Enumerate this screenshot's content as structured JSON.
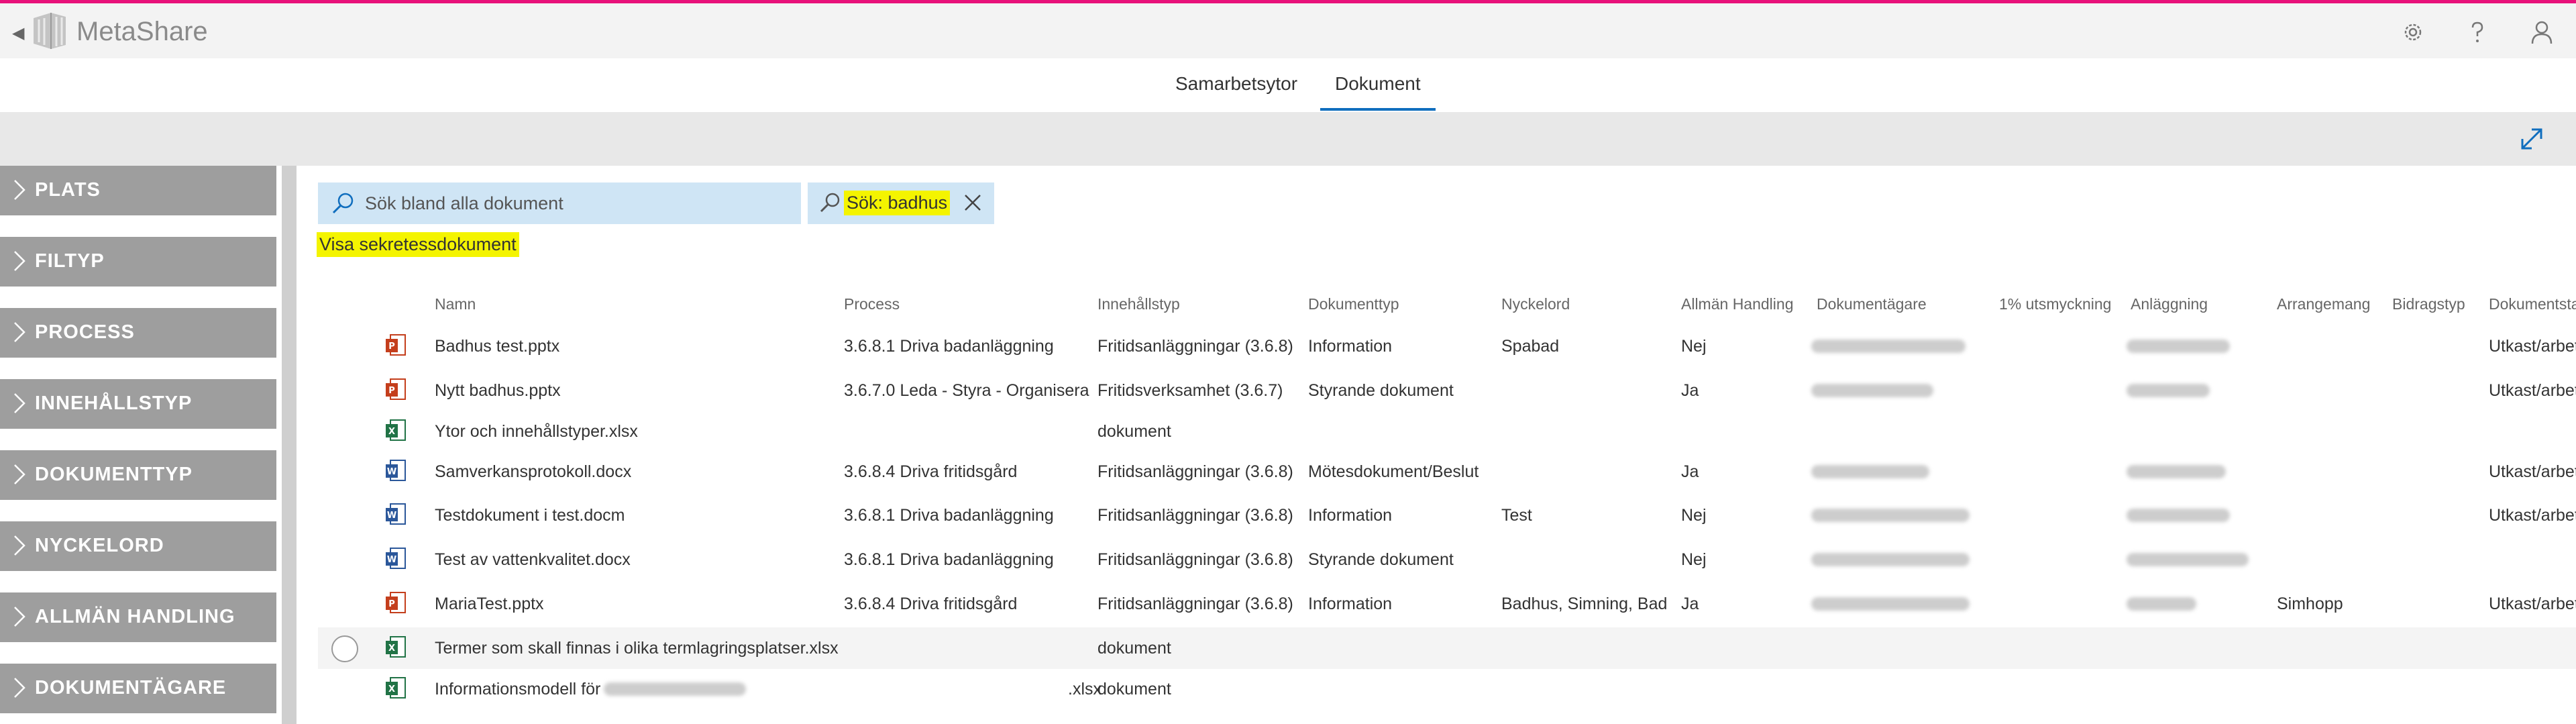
{
  "app": {
    "title": "MetaShare"
  },
  "nav": {
    "tabs": [
      {
        "label": "Samarbetsytor"
      },
      {
        "label": "Dokument"
      }
    ]
  },
  "sidebar": {
    "items": [
      {
        "label": "PLATS"
      },
      {
        "label": "FILTYP"
      },
      {
        "label": "PROCESS"
      },
      {
        "label": "INNEHÅLLSTYP"
      },
      {
        "label": "DOKUMENTTYP"
      },
      {
        "label": "NYCKELORD"
      },
      {
        "label": "ALLMÄN HANDLING"
      },
      {
        "label": "DOKUMENTÄGARE"
      }
    ]
  },
  "search": {
    "placeholder": "Sök bland alla dokument",
    "chip_label": "Sök: badhus"
  },
  "secret_link": "Visa sekretessdokument",
  "table": {
    "columns": [
      "Namn",
      "Process",
      "Innehållstyp",
      "Dokumenttyp",
      "Nyckelord",
      "Allmän Handling",
      "Dokumentägare",
      "1% utsmyckning",
      "Anläggning",
      "Arrangemang",
      "Bidragstyp",
      "Dokumentsta"
    ],
    "rows": [
      {
        "type": "pptx",
        "name": "Badhus test.pptx",
        "process": "3.6.8.1 Driva badanläggning",
        "innehallstyp": "Fritidsanläggningar (3.6.8)",
        "dokumenttyp": "Information",
        "nyckelord": "Spabad",
        "allman": "Nej",
        "arrangemang": "",
        "status": "Utkast/arbet"
      },
      {
        "type": "pptx",
        "name": "Nytt badhus.pptx",
        "process": "3.6.7.0 Leda - Styra - Organisera",
        "innehallstyp": "Fritidsverksamhet (3.6.7)",
        "dokumenttyp": "Styrande dokument",
        "nyckelord": "",
        "allman": "Ja",
        "arrangemang": "",
        "status": "Utkast/arbet"
      },
      {
        "type": "xlsx",
        "name": "Ytor och innehållstyper.xlsx",
        "process": "",
        "innehallstyp": "dokument",
        "dokumenttyp": "",
        "nyckelord": "",
        "allman": "",
        "arrangemang": "",
        "status": ""
      },
      {
        "type": "docx",
        "name": "Samverkansprotokoll.docx",
        "process": "3.6.8.4 Driva fritidsgård",
        "innehallstyp": "Fritidsanläggningar (3.6.8)",
        "dokumenttyp": "Mötesdokument/Beslut",
        "nyckelord": "",
        "allman": "Ja",
        "arrangemang": "",
        "status": "Utkast/arbet"
      },
      {
        "type": "docx",
        "name": "Testdokument i test.docm",
        "process": "3.6.8.1 Driva badanläggning",
        "innehallstyp": "Fritidsanläggningar (3.6.8)",
        "dokumenttyp": "Information",
        "nyckelord": "Test",
        "allman": "Nej",
        "arrangemang": "",
        "status": "Utkast/arbet"
      },
      {
        "type": "docx",
        "name": "Test av vattenkvalitet.docx",
        "process": "3.6.8.1 Driva badanläggning",
        "innehallstyp": "Fritidsanläggningar (3.6.8)",
        "dokumenttyp": "Styrande dokument",
        "nyckelord": "",
        "allman": "Nej",
        "arrangemang": "",
        "status": ""
      },
      {
        "type": "pptx",
        "name": "MariaTest.pptx",
        "process": "3.6.8.4 Driva fritidsgård",
        "innehallstyp": "Fritidsanläggningar (3.6.8)",
        "dokumenttyp": "Information",
        "nyckelord": "Badhus, Simning, Bad",
        "allman": "Ja",
        "arrangemang": "Simhopp",
        "status": "Utkast/arbet"
      },
      {
        "type": "xlsx",
        "name": "Termer som skall finnas i olika termlagringsplatser.xlsx",
        "process": "",
        "innehallstyp": "dokument",
        "dokumenttyp": "",
        "nyckelord": "",
        "allman": "",
        "arrangemang": "",
        "status": ""
      },
      {
        "type": "xlsx",
        "name": "Informationsmodell för",
        "name_suffix": ".xlsx",
        "process": "",
        "innehallstyp": "dokument",
        "dokumenttyp": "",
        "nyckelord": "",
        "allman": "",
        "arrangemang": "",
        "status": ""
      }
    ]
  },
  "colors": {
    "accent_line": "#e8117a",
    "nav_underline": "#106ebe",
    "highlight": "#f4f400",
    "search_bg": "#cfe5f5",
    "sidebar_bg": "#9e9e9e"
  },
  "icons": {
    "settings": "gear-icon",
    "help": "question-icon",
    "user": "user-icon",
    "expand": "expand-icon",
    "search": "search-icon",
    "close": "close-icon"
  }
}
